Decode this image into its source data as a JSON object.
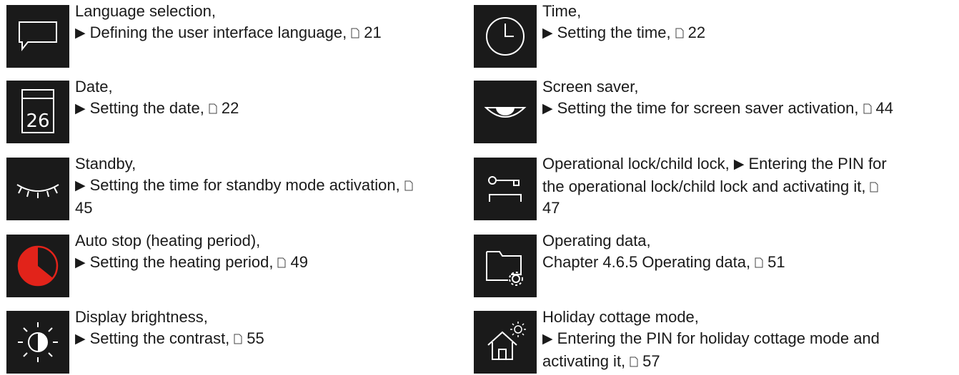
{
  "left": [
    {
      "icon": "speech-bubble-icon",
      "title": "Language selection,",
      "action": "Defining the user interface language,",
      "page": "21"
    },
    {
      "icon": "calendar-icon",
      "icon_text": "26",
      "title": "Date,",
      "action": "Setting the date,",
      "page": "22"
    },
    {
      "icon": "closed-eye-icon",
      "title": "Standby,",
      "action": "Setting the time for standby mode activation,",
      "page": "45"
    },
    {
      "icon": "auto-stop-clock-icon",
      "title": "Auto stop (heating period),",
      "action": "Setting the heating period,",
      "page": "49"
    },
    {
      "icon": "brightness-icon",
      "title": "Display brightness,",
      "action": "Setting the contrast,",
      "page": "55"
    }
  ],
  "right": [
    {
      "icon": "clock-icon",
      "title": "Time,",
      "action": "Setting the time,",
      "page": "22"
    },
    {
      "icon": "eye-icon",
      "title": "Screen saver,",
      "action": "Setting the time for screen saver activation,",
      "page": "44"
    },
    {
      "icon": "key-lock-icon",
      "title": "Operational lock/child lock,",
      "action": "Entering the PIN for the operational lock/child lock and activating it,",
      "page": "47"
    },
    {
      "icon": "folder-gear-icon",
      "title": "Operating data,",
      "action": "Chapter 4.6.5 Operating data,",
      "page": "51"
    },
    {
      "icon": "house-sun-icon",
      "title": "Holiday cottage mode,",
      "action": "Entering the PIN for holiday cottage mode and activating it,",
      "page": "57"
    }
  ],
  "colors": {
    "icon_bg": "#1a1a1a",
    "icon_line": "#ffffff",
    "accent_red": "#e2231a"
  }
}
